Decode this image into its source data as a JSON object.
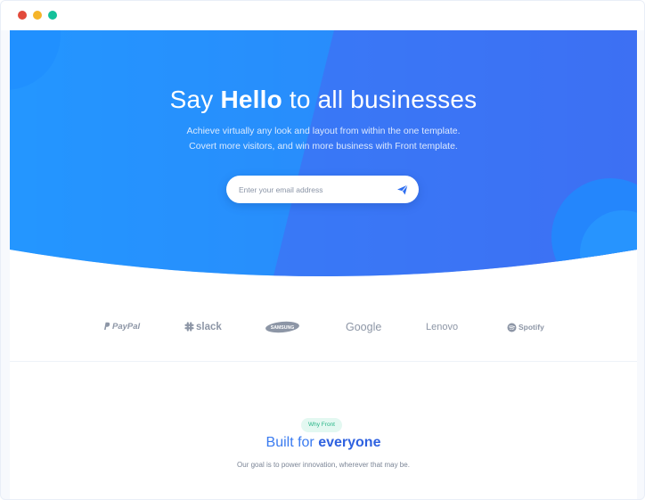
{
  "window": {
    "controls": [
      "close",
      "minimize",
      "maximize"
    ]
  },
  "hero": {
    "title_prefix": "Say ",
    "title_bold": "Hello",
    "title_suffix": " to all businesses",
    "subtitle_line1": "Achieve virtually any look and layout from within the one template.",
    "subtitle_line2": "Covert more visitors, and win more business with Front template.",
    "email_placeholder": "Enter your email address",
    "submit_icon": "paper-plane-icon"
  },
  "logos": [
    {
      "name": "PayPal"
    },
    {
      "name": "slack"
    },
    {
      "name": "SAMSUNG"
    },
    {
      "name": "Google"
    },
    {
      "name": "Lenovo"
    },
    {
      "name": "Spotify"
    }
  ],
  "why": {
    "badge": "Why Front",
    "title_prefix": "Built for ",
    "title_bold": "everyone",
    "subtitle": "Our goal is to power innovation, wherever that may be."
  },
  "colors": {
    "hero_blue_left": "#2f9bff",
    "hero_blue_right": "#3b72f2",
    "accent": "#377dff",
    "badge_bg": "#e3f8f1",
    "badge_text": "#26b487",
    "logo_gray": "#8d96a6",
    "dot_red": "#e24a3b",
    "dot_yellow": "#f5b428",
    "dot_green": "#14c19a"
  }
}
